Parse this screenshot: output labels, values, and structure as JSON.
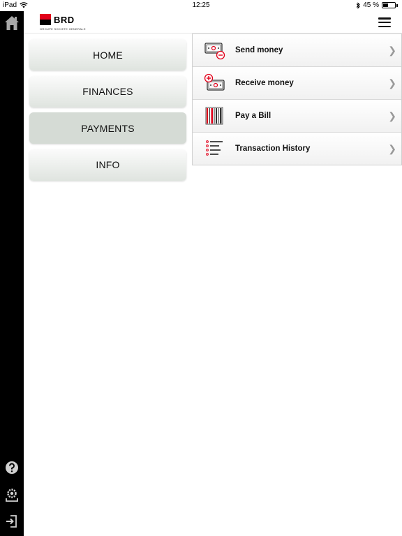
{
  "status": {
    "device": "iPad",
    "time": "12:25",
    "battery_text": "45 %",
    "battery_level": 0.45
  },
  "brand": {
    "name": "BRD",
    "subtitle": "GROUPE SOCIETE GENERALE",
    "colors": {
      "red": "#e2001a",
      "black": "#000000"
    }
  },
  "rail": {
    "icons": [
      "home-icon",
      "help-icon",
      "settings-icon",
      "logout-icon"
    ]
  },
  "nav": {
    "items": [
      {
        "label": "HOME",
        "active": false
      },
      {
        "label": "FINANCES",
        "active": false
      },
      {
        "label": "PAYMENTS",
        "active": true
      },
      {
        "label": "INFO",
        "active": false
      }
    ]
  },
  "submenu": {
    "items": [
      {
        "label": "Send money",
        "icon": "send-money-icon"
      },
      {
        "label": "Receive money",
        "icon": "receive-money-icon"
      },
      {
        "label": "Pay a Bill",
        "icon": "barcode-icon"
      },
      {
        "label": "Transaction History",
        "icon": "history-list-icon"
      }
    ]
  }
}
